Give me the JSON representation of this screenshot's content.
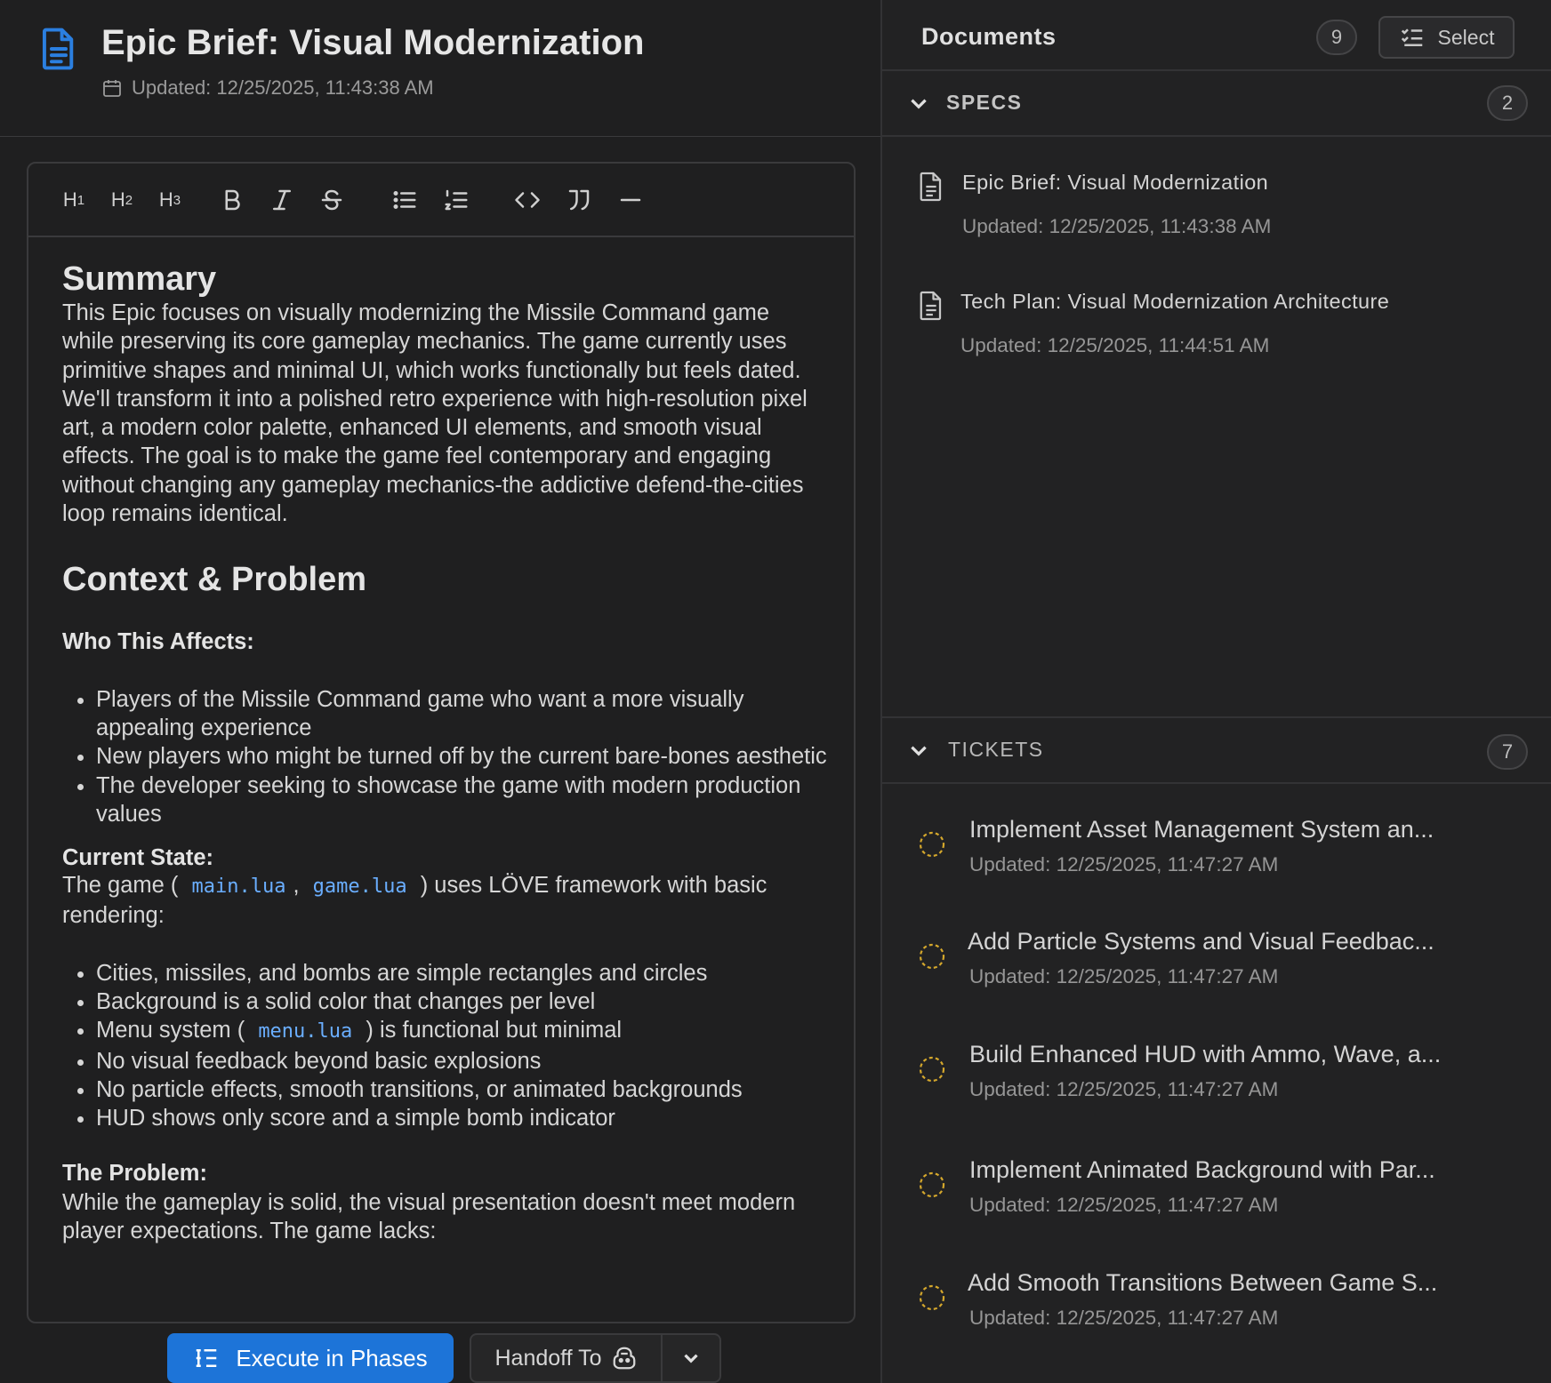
{
  "document": {
    "title": "Epic Brief: Visual Modernization",
    "updated": "Updated: 12/25/2025, 11:43:38 AM"
  },
  "toolbar": {
    "h1": "H",
    "h1_sub": "1",
    "h2": "H",
    "h2_sub": "2",
    "h3": "H",
    "h3_sub": "3",
    "icons": [
      "bold-icon",
      "italic-icon",
      "strikethrough-icon",
      "bullet-list-icon",
      "numbered-list-icon",
      "code-icon",
      "quote-icon",
      "horizontal-rule-icon"
    ]
  },
  "content": {
    "summary_heading": "Summary",
    "summary_text": "This Epic focuses on visually modernizing the Missile Command game while preserving its core gameplay mechanics. The game currently uses primitive shapes and minimal UI, which works functionally but feels dated. We'll transform it into a polished retro experience with high-resolution pixel art, a modern color palette, enhanced UI elements, and smooth visual effects. The goal is to make the game feel contemporary and engaging without changing any gameplay mechanics-the addictive defend-the-cities loop remains identical.",
    "context_heading": "Context & Problem",
    "who_label": "Who This Affects:",
    "who_items": [
      "Players of the Missile Command game who want a more visually appealing experience",
      "New players who might be turned off by the current bare-bones aesthetic",
      "The developer seeking to showcase the game with modern production values"
    ],
    "current_label": "Current State:",
    "current_pre": "The game (",
    "current_code1": "main.lua",
    "current_sep": ",",
    "current_code2": "game.lua",
    "current_post": ") uses LÖVE framework with basic rendering:",
    "state_items_1": "Cities, missiles, and bombs are simple rectangles and circles",
    "state_items_2": "Background is a solid color that changes per level",
    "state_menu_pre": "Menu system (",
    "state_menu_code": "menu.lua",
    "state_menu_post": ") is functional but minimal",
    "state_items_4": "No visual feedback beyond basic explosions",
    "state_items_5": "No particle effects, smooth transitions, or animated backgrounds",
    "state_items_6": "HUD shows only score and a simple bomb indicator",
    "problem_label": "The Problem:",
    "problem_text": "While the gameplay is solid, the visual presentation doesn't meet modern player expectations. The game lacks:"
  },
  "actions": {
    "execute_label": "Execute in Phases",
    "handoff_label": "Handoff To"
  },
  "sidebar": {
    "title": "Documents",
    "count": "9",
    "select_label": "Select",
    "specs": {
      "label": "SPECS",
      "count": "2",
      "items": [
        {
          "title": "Epic Brief: Visual Modernization",
          "updated": "Updated: 12/25/2025, 11:43:38 AM"
        },
        {
          "title": "Tech Plan: Visual Modernization Architecture",
          "updated": "Updated: 12/25/2025, 11:44:51 AM"
        }
      ]
    },
    "tickets": {
      "label": "TICKETS",
      "count": "7",
      "status_color": "#d4a72c",
      "items": [
        {
          "title": "Implement Asset Management System an...",
          "updated": "Updated: 12/25/2025, 11:47:27 AM"
        },
        {
          "title": "Add Particle Systems and Visual Feedbac...",
          "updated": "Updated: 12/25/2025, 11:47:27 AM"
        },
        {
          "title": "Build Enhanced HUD with Ammo, Wave, a...",
          "updated": "Updated: 12/25/2025, 11:47:27 AM"
        },
        {
          "title": "Implement Animated Background with Par...",
          "updated": "Updated: 12/25/2025, 11:47:27 AM"
        },
        {
          "title": "Add Smooth Transitions Between Game S...",
          "updated": "Updated: 12/25/2025, 11:47:27 AM"
        }
      ]
    }
  },
  "colors": {
    "accent": "#1d74d8",
    "code": "#6aaeff",
    "background": "#1f1f20"
  }
}
